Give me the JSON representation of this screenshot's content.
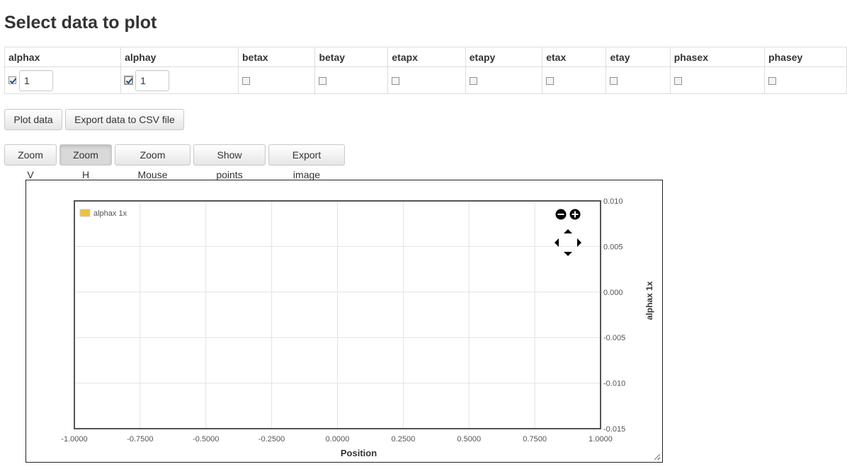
{
  "page": {
    "title": "Select data to plot"
  },
  "columns": [
    {
      "name": "alphax",
      "checked": true,
      "value": "1",
      "has_input": true
    },
    {
      "name": "alphay",
      "checked": true,
      "value": "1",
      "has_input": true
    },
    {
      "name": "betax",
      "checked": false
    },
    {
      "name": "betay",
      "checked": false
    },
    {
      "name": "etapx",
      "checked": false
    },
    {
      "name": "etapy",
      "checked": false
    },
    {
      "name": "etax",
      "checked": false
    },
    {
      "name": "etay",
      "checked": false
    },
    {
      "name": "phasex",
      "checked": false
    },
    {
      "name": "phasey",
      "checked": false
    }
  ],
  "actions": {
    "plot_label": "Plot data",
    "export_csv_label": "Export data to CSV file"
  },
  "toolbar": {
    "zoom_v_label": "Zoom V",
    "zoom_h_label": "Zoom H",
    "zoom_mouse_label": "Zoom Mouse",
    "show_points_label": "Show points",
    "export_image_label": "Export image",
    "active": "zoom_h"
  },
  "chart_data": {
    "type": "line",
    "x": [],
    "series": [
      {
        "name": "alphax 1x",
        "values": [],
        "color": "#edc240"
      }
    ],
    "xlabel": "Position",
    "ylabel": "alphax 1x",
    "xlim": [
      -1.0,
      1.0
    ],
    "ylim": [
      -0.015,
      0.01
    ],
    "xticks": [
      "-1.0000",
      "-0.7500",
      "-0.5000",
      "-0.2500",
      "0.0000",
      "0.2500",
      "0.5000",
      "0.7500",
      "1.0000"
    ],
    "yticks": [
      "0.010",
      "0.005",
      "0.000",
      "-0.005",
      "-0.010",
      "-0.015"
    ],
    "grid": true,
    "legend_position": "top-left",
    "y_axis_side": "right"
  }
}
